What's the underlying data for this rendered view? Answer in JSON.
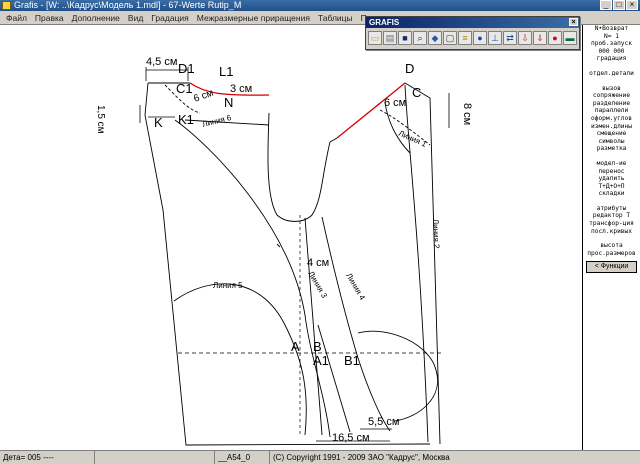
{
  "window": {
    "title": "Grafis - [W: ..\\Кадрус\\Модель 1.mdl] - 67-Werte Rutip_M",
    "controls": [
      "_",
      "□",
      "×"
    ]
  },
  "menu": [
    "Файл",
    "Правка",
    "Дополнение",
    "Вид",
    "Градация",
    "Межразмерные приращения",
    "Таблицы",
    "Помощь"
  ],
  "toolbar_window": {
    "title": "GRAFIS",
    "close": "×",
    "icons": [
      {
        "name": "open-folder-icon",
        "glyph": "▭",
        "color": "#c89a2e"
      },
      {
        "name": "open-file-icon",
        "glyph": "▤",
        "color": "#6b6b6b"
      },
      {
        "name": "save-icon",
        "glyph": "■",
        "color": "#1b2a6b"
      },
      {
        "name": "zoom-icon",
        "glyph": "⌕",
        "color": "#2a2a2a"
      },
      {
        "name": "layers-icon",
        "glyph": "◆",
        "color": "#2c5aa0"
      },
      {
        "name": "frame-icon",
        "glyph": "▢",
        "color": "#333333"
      },
      {
        "name": "ruler-icon",
        "glyph": "≡",
        "color": "#b08a00"
      },
      {
        "name": "globe-icon",
        "glyph": "●",
        "color": "#1a4fa0"
      },
      {
        "name": "measure-icon",
        "glyph": "⊥",
        "color": "#1a4fa0"
      },
      {
        "name": "swap-icon",
        "glyph": "⇄",
        "color": "#1a4fa0"
      },
      {
        "name": "download-icon",
        "glyph": "⇩",
        "color": "#c0392b"
      },
      {
        "name": "export-icon",
        "glyph": "⇓",
        "color": "#c0392b"
      },
      {
        "name": "stop-icon",
        "glyph": "●",
        "color": "#d0021b"
      },
      {
        "name": "terminal-icon",
        "glyph": "▬",
        "color": "#0b6b4a"
      }
    ]
  },
  "right_panel": {
    "groups": [
      [
        "N•Возврат",
        "N=   1",
        "проб.запуск",
        "000 000",
        "градация"
      ],
      [
        "отдел.детали"
      ],
      [
        "вызов",
        "сопряжение",
        "разделение",
        "параллели",
        "оформ.углов",
        "измен.длины",
        "смещение",
        "символы",
        "разметка"
      ],
      [
        "модел-ие",
        "перенос",
        "удалить",
        "T+Д+О+П",
        "складки"
      ],
      [
        "атрибуты",
        "редактор T",
        "трансфор-ция",
        "поcл.кривых"
      ],
      [
        "высота",
        "прос.размеров"
      ]
    ],
    "functions_button": "< Функции"
  },
  "status": {
    "cell1": "Дета= 005   ----",
    "cell2": "",
    "cell3": "__A54_0",
    "cell4": "(C) Copyright 1991 - 2009 ЗАО \"Кадрус\", Москва"
  },
  "drawing": {
    "labels": {
      "dim_45": "4,5 см",
      "d1": "D1",
      "l1": "L1",
      "dim_3": "3 см",
      "c1": "C1",
      "dim_6_left": "6 см",
      "n": "N",
      "dim_15": "1,5 см",
      "k": "K",
      "k1": "K1",
      "line6": "Линия 6",
      "d": "D",
      "c": "C",
      "dim_6_right": "6 см",
      "dim_8": "8 см",
      "line1": "Линия 1",
      "line2": "Линия 2",
      "dim_4": "4 см",
      "line3": "Линия 3",
      "line4": "Линия 4",
      "line5": "Линия 5",
      "a": "A",
      "b": "B",
      "a1": "A1",
      "b1": "B1",
      "dim_55": "5,5 см",
      "dim_165": "16,5 см"
    },
    "colors": {
      "line": "#000000",
      "red_line": "#d40000"
    }
  }
}
